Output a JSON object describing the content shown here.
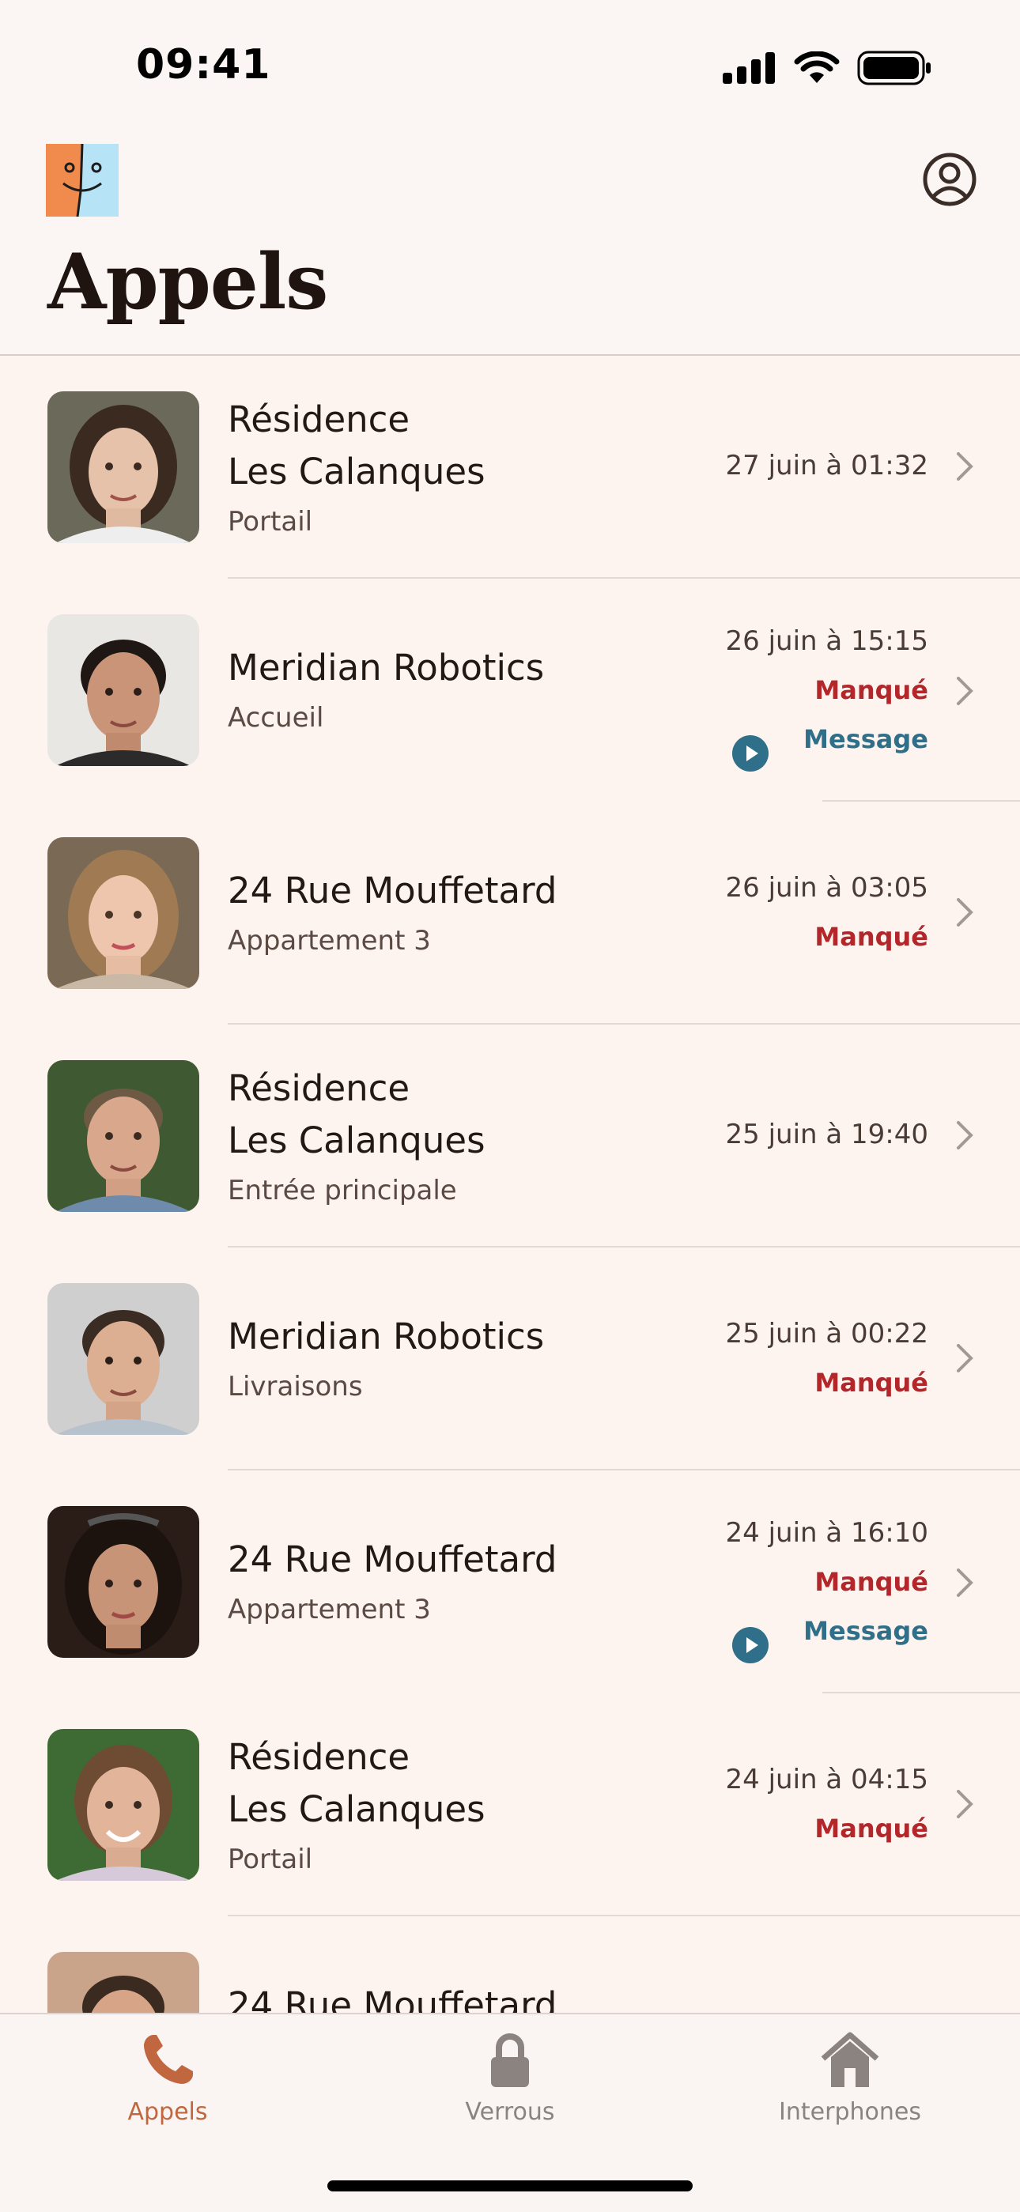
{
  "status_bar": {
    "time": "09:41"
  },
  "header": {
    "title": "Appels"
  },
  "calls": [
    {
      "name_line1": "Résidence",
      "name_line2": "Les Calanques",
      "location": "Portail",
      "date": "27 juin à 01:32",
      "missed": "",
      "message": ""
    },
    {
      "name_line1": "Meridian Robotics",
      "name_line2": "",
      "location": "Accueil",
      "date": "26 juin à 15:15",
      "missed": "Manqué",
      "message": "Message"
    },
    {
      "name_line1": "24 Rue Mouffetard",
      "name_line2": "",
      "location": "Appartement 3",
      "date": "26 juin à 03:05",
      "missed": "Manqué",
      "message": ""
    },
    {
      "name_line1": "Résidence",
      "name_line2": "Les Calanques",
      "location": "Entrée principale",
      "date": "25 juin à 19:40",
      "missed": "",
      "message": ""
    },
    {
      "name_line1": "Meridian Robotics",
      "name_line2": "",
      "location": "Livraisons",
      "date": "25 juin à 00:22",
      "missed": "Manqué",
      "message": ""
    },
    {
      "name_line1": "24 Rue Mouffetard",
      "name_line2": "",
      "location": "Appartement 3",
      "date": "24 juin à 16:10",
      "missed": "Manqué",
      "message": "Message"
    },
    {
      "name_line1": "Résidence",
      "name_line2": "Les Calanques",
      "location": "Portail",
      "date": "24 juin à 04:15",
      "missed": "Manqué",
      "message": ""
    },
    {
      "name_line1": "24 Rue Mouffetard",
      "name_line2": "",
      "location": "",
      "date": "",
      "missed": "",
      "message": ""
    }
  ],
  "tabs": [
    {
      "label": "Appels",
      "icon": "phone-icon",
      "active": true
    },
    {
      "label": "Verrous",
      "icon": "lock-icon",
      "active": false
    },
    {
      "label": "Interphones",
      "icon": "house-icon",
      "active": false
    }
  ],
  "colors": {
    "accent": "#c0673f",
    "missed": "#b3262a",
    "message": "#2f6f8a",
    "inactive_tab": "#8a8380",
    "background": "#fdf3ef"
  }
}
